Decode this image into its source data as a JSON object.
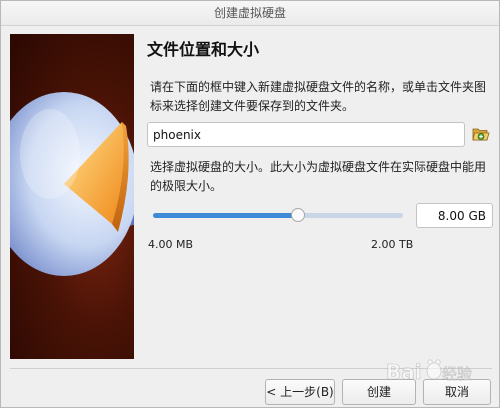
{
  "window": {
    "title": "创建虚拟硬盘"
  },
  "page": {
    "title": "文件位置和大小",
    "description": "请在下面的框中键入新建虚拟硬盘文件的名称，或单击文件夹图标来选择创建文件要保存到的文件夹。",
    "size_description": "选择虚拟硬盘的大小。此大小为虚拟硬盘文件在实际硬盘中能用的极限大小。"
  },
  "file": {
    "name": "phoenix",
    "folder_icon": "folder-open-icon"
  },
  "size": {
    "value": "8.00 GB",
    "slider_fraction": 0.58,
    "min_label": "4.00 MB",
    "max_label": "2.00 TB"
  },
  "buttons": {
    "back": "< 上一步(B)",
    "create": "创建",
    "cancel": "取消"
  },
  "colors": {
    "accent": "#3f8ad6",
    "banner_bg": "#4a1306"
  }
}
